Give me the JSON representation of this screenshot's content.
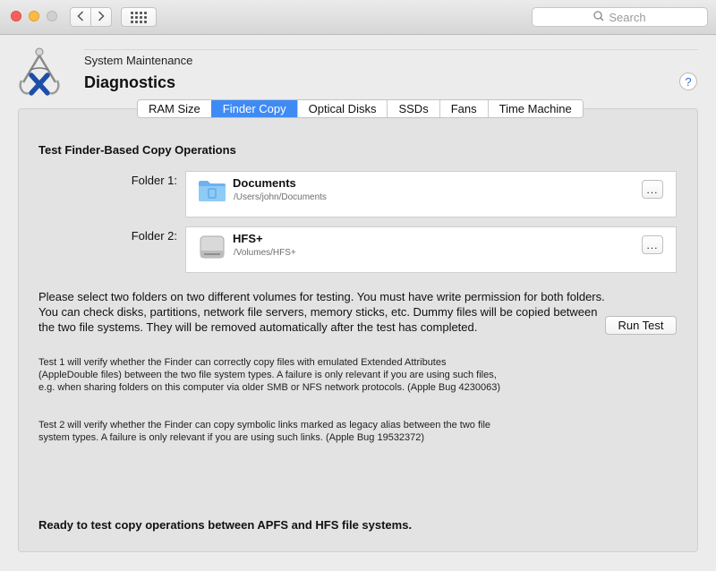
{
  "toolbar": {
    "search_placeholder": "Search"
  },
  "header": {
    "subtitle": "System Maintenance",
    "title": "Diagnostics",
    "help_label": "?"
  },
  "tabs": [
    {
      "label": "RAM Size",
      "active": false
    },
    {
      "label": "Finder Copy",
      "active": true
    },
    {
      "label": "Optical Disks",
      "active": false
    },
    {
      "label": "SSDs",
      "active": false
    },
    {
      "label": "Fans",
      "active": false
    },
    {
      "label": "Time Machine",
      "active": false
    }
  ],
  "main": {
    "section_title": "Test Finder-Based Copy Operations",
    "folder1": {
      "label": "Folder 1:",
      "name": "Documents",
      "path": "/Users/john/Documents",
      "icon": "folder-icon",
      "button_label": "..."
    },
    "folder2": {
      "label": "Folder 2:",
      "name": "HFS+",
      "path": "/Volumes/HFS+",
      "icon": "hard-disk-icon",
      "button_label": "..."
    },
    "instructions": "Please select two folders on two different volumes for testing. You must have write permission for both folders. You can check disks, partitions, network file servers, memory sticks, etc. Dummy files will be copied between the two file systems. They will be removed automatically after the test has completed.",
    "run_button": "Run Test",
    "test1_text": "Test 1 will verify whether the Finder can correctly copy files with emulated Extended Attributes (AppleDouble files) between the two file system types. A failure is only relevant if you are using such files, e.g. when sharing folders on this computer via older SMB or NFS network protocols. (Apple Bug 4230063)",
    "test2_text": "Test 2 will verify whether the Finder can copy symbolic links marked as legacy alias between the two file system types. A failure is only relevant if you are using such links. (Apple Bug 19532372)",
    "status": "Ready to test copy operations between APFS and HFS file systems."
  },
  "colors": {
    "accent": "#3f8bf5",
    "folder_blue": "#7ec0f5"
  }
}
